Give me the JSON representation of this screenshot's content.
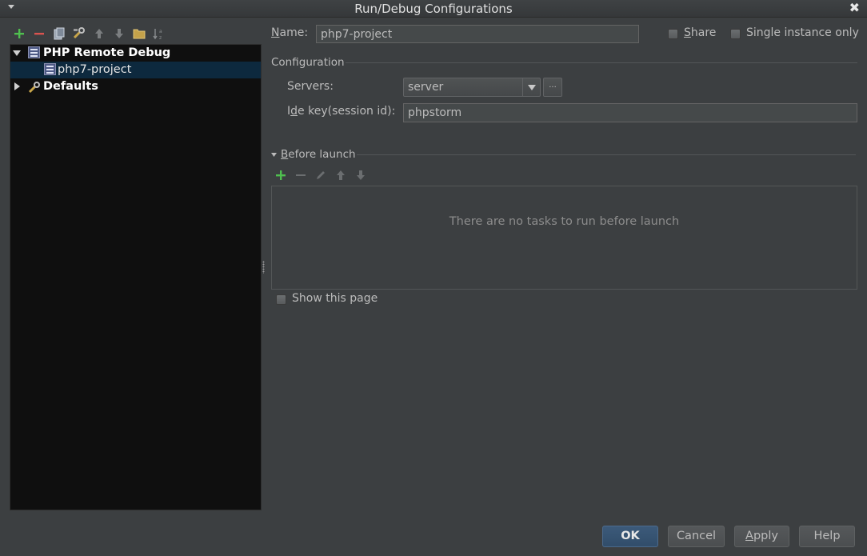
{
  "window": {
    "title": "Run/Debug Configurations",
    "close_glyph": "✖"
  },
  "toolbar": {
    "icons": [
      "add-icon",
      "remove-icon",
      "copy-icon",
      "edit-defaults-icon",
      "move-up-icon",
      "move-down-icon",
      "folder-icon",
      "sort-alpha-icon"
    ]
  },
  "tree": {
    "items": [
      {
        "label": "PHP Remote Debug",
        "expanded": true,
        "bold": true,
        "icon": "php-remote-debug-icon"
      },
      {
        "label": "php7-project",
        "selected": true,
        "icon": "php-config-icon"
      },
      {
        "label": "Defaults",
        "expanded": false,
        "bold": true,
        "icon": "wrench-icon"
      }
    ]
  },
  "form": {
    "name_label_u": "N",
    "name_label_rest": "ame:",
    "name_value": "php7-project",
    "share_label_u": "S",
    "share_label_rest": "hare",
    "single_instance_label": "Single instance only",
    "configuration_header": "Configuration",
    "servers_label": "Servers:",
    "servers_value": "server",
    "browse_label": "...",
    "ide_key_label_pre": "I",
    "ide_key_label_u": "d",
    "ide_key_label_rest": "e key(session id):",
    "ide_key_value": "phpstorm"
  },
  "before_launch": {
    "header_u": "B",
    "header_rest": "efore launch",
    "empty_text": "There are no tasks to run before launch",
    "show_page_label": "Show this page"
  },
  "buttons": {
    "ok": "OK",
    "cancel": "Cancel",
    "apply_u": "A",
    "apply_rest": "pply",
    "help": "Help"
  },
  "colors": {
    "background": "#3c3f41",
    "tree_background": "#0f0f0f",
    "selection": "#0d293e",
    "add_green": "#4fbf4f",
    "remove_red": "#d9534f"
  }
}
